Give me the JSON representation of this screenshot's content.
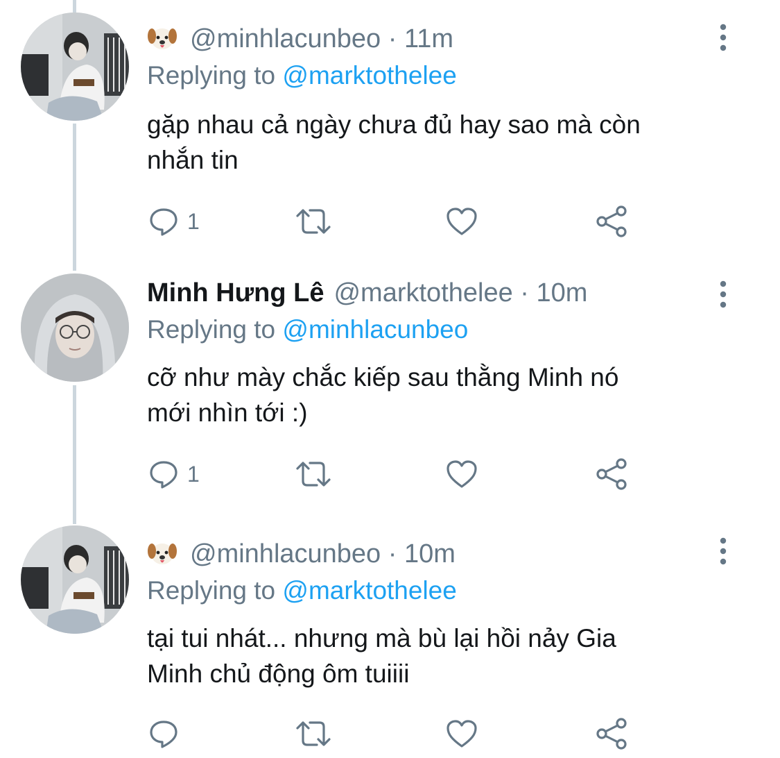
{
  "tweets": [
    {
      "display_name": "",
      "username": "@minhlacunbeo",
      "time": "11m",
      "emoji_icon": "dog-face-emoji",
      "replying_label": "Replying to",
      "replying_to": "@marktothelee",
      "text_line1": "gặp nhau cả ngày chưa đủ hay sao mà còn",
      "text_line2": "nhắn tin",
      "reply_count": "1",
      "retweet_count": "",
      "like_count": ""
    },
    {
      "display_name": "Minh Hưng Lê",
      "username": "@marktothelee",
      "time": "10m",
      "replying_label": "Replying to",
      "replying_to": "@minhlacunbeo",
      "text_line1": "cỡ như mày chắc kiếp sau thằng Minh nó",
      "text_line2": "mới nhìn tới :)",
      "reply_count": "1",
      "retweet_count": "",
      "like_count": ""
    },
    {
      "display_name": "",
      "username": "@minhlacunbeo",
      "time": "10m",
      "emoji_icon": "dog-face-emoji",
      "replying_label": "Replying to",
      "replying_to": "@marktothelee",
      "text_line1": "tại tui nhát... nhưng mà bù lại hồi nảy Gia",
      "text_line2": "Minh chủ động ôm tuiiii",
      "reply_count": "",
      "retweet_count": "",
      "like_count": ""
    }
  ],
  "separator": "·",
  "colors": {
    "link": "#1da1f2",
    "secondary": "#657786",
    "text": "#14171a",
    "thread_line": "#ccd6dd"
  }
}
